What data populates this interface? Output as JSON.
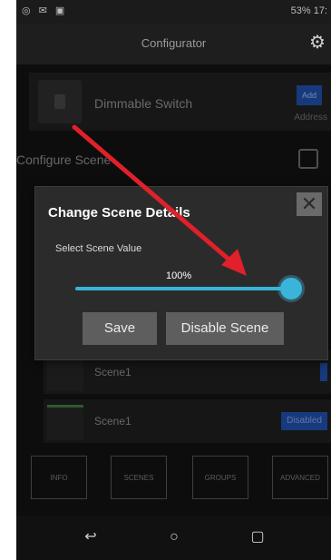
{
  "status_bar": {
    "battery_time": "53% 17:"
  },
  "app_bar": {
    "title": "Configurator",
    "settings_icon": "gear-icon"
  },
  "device": {
    "name": "Dimmable Switch",
    "address_button": "Add",
    "address_label": "Address"
  },
  "section": {
    "title": "Configure Scene"
  },
  "dialog": {
    "title": "Change Scene Details",
    "select_label": "Select Scene Value",
    "value": "100%",
    "slider_level": 1.0,
    "save_label": "Save",
    "disable_label": "Disable Scene"
  },
  "scenes": [
    {
      "label": "Scene1",
      "tag": ""
    },
    {
      "label": "Scene1",
      "tag": "Disabled"
    }
  ],
  "bottom_nav": [
    "INFO",
    "SCENES",
    "GROUPS",
    "ADVANCED"
  ],
  "colors": {
    "accent": "#3bb4d9",
    "annotation_arrow": "#e0202a",
    "badge_blue": "#1f4ea8"
  }
}
